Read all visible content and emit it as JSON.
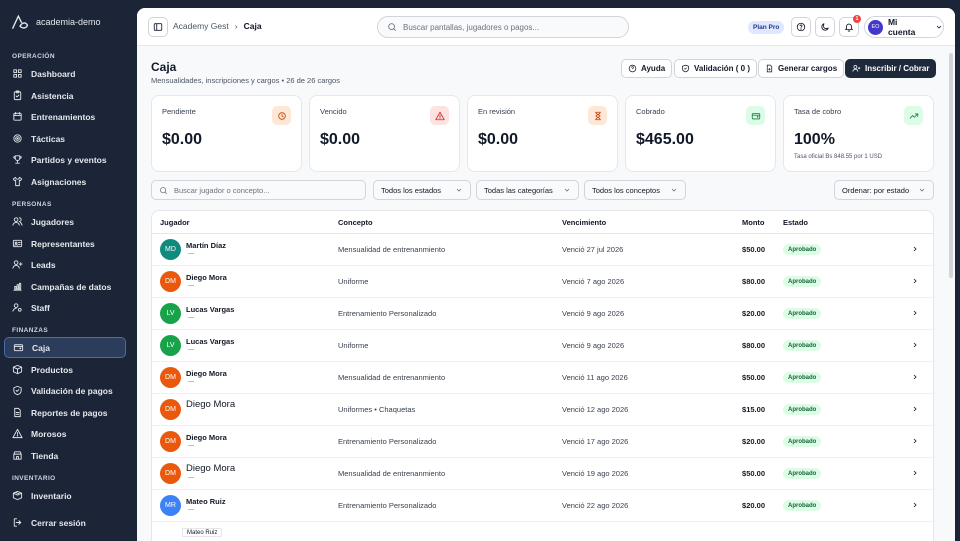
{
  "brand": {
    "name": "academia-demo"
  },
  "sidebar": {
    "sections": [
      {
        "title": "OPERACIÓN",
        "items": [
          {
            "label": "Dashboard",
            "icon": "grid-icon"
          },
          {
            "label": "Asistencia",
            "icon": "clipboard-icon"
          },
          {
            "label": "Entrenamientos",
            "icon": "calendar-icon"
          },
          {
            "label": "Tácticas",
            "icon": "target-icon"
          },
          {
            "label": "Partidos y eventos",
            "icon": "trophy-icon"
          },
          {
            "label": "Asignaciones",
            "icon": "shirt-icon"
          }
        ]
      },
      {
        "title": "PERSONAS",
        "items": [
          {
            "label": "Jugadores",
            "icon": "users-icon"
          },
          {
            "label": "Representantes",
            "icon": "id-card-icon"
          },
          {
            "label": "Leads",
            "icon": "user-plus-icon"
          },
          {
            "label": "Campañas de datos",
            "icon": "chart-icon"
          },
          {
            "label": "Staff",
            "icon": "user-cog-icon"
          }
        ]
      },
      {
        "title": "FINANZAS",
        "items": [
          {
            "label": "Caja",
            "icon": "wallet-icon",
            "active": true
          },
          {
            "label": "Productos",
            "icon": "box-icon"
          },
          {
            "label": "Validación de pagos",
            "icon": "shield-check-icon"
          },
          {
            "label": "Reportes de pagos",
            "icon": "file-icon"
          },
          {
            "label": "Morosos",
            "icon": "alert-icon"
          },
          {
            "label": "Tienda",
            "icon": "store-icon"
          }
        ]
      },
      {
        "title": "INVENTARIO",
        "items": [
          {
            "label": "Inventario",
            "icon": "package-icon"
          }
        ]
      }
    ],
    "logout": "Cerrar sesión"
  },
  "topbar": {
    "breadcrumb_root": "Academy Gest",
    "breadcrumb_sep": "›",
    "breadcrumb_current": "Caja",
    "search_placeholder": "Buscar pantallas, jugadores o pagos...",
    "plan": "Plan Pro",
    "notif_count": "1",
    "account_initials": "EO",
    "account_label": "Mi cuenta"
  },
  "page": {
    "title": "Caja",
    "subtitle": "Mensualidades, inscripciones y cargos • 26 de 26 cargos",
    "buttons": {
      "help": "Ayuda",
      "validation": "Validación ( 0 )",
      "generate": "Generar cargos",
      "enroll": "Inscribir / Cobrar"
    }
  },
  "stats": [
    {
      "label": "Pendiente",
      "value": "$0.00",
      "icon": "clock-icon",
      "color": "#fde8d7",
      "stroke": "#c2410c"
    },
    {
      "label": "Vencido",
      "value": "$0.00",
      "icon": "warning-icon",
      "color": "#fde2e2",
      "stroke": "#dc2626"
    },
    {
      "label": "En revisión",
      "value": "$0.00",
      "icon": "hourglass-icon",
      "color": "#fde8d7",
      "stroke": "#c2410c"
    },
    {
      "label": "Cobrado",
      "value": "$465.00",
      "icon": "wallet-icon",
      "color": "#dcfce7",
      "stroke": "#15803d"
    },
    {
      "label": "Tasa de cobro",
      "value": "100%",
      "sub": "Tasa oficial Bs 848.55 por 1 USD",
      "icon": "trend-up-icon",
      "color": "#dcfce7",
      "stroke": "#15803d"
    }
  ],
  "filters": {
    "search_placeholder": "Buscar jugador o concepto...",
    "states": "Todos los estados",
    "categories": "Todas las categorías",
    "concepts": "Todos los conceptos",
    "order": "Ordenar: por estado"
  },
  "table": {
    "headers": {
      "player": "Jugador",
      "concept": "Concepto",
      "due": "Vencimiento",
      "amount": "Monto",
      "status": "Estado"
    },
    "rows": [
      {
        "initials": "MD",
        "name": "Martín Díaz",
        "dash": "—",
        "concept": "Mensualidad de entrenanmiento",
        "due": "Venció 27 jul 2026",
        "amount": "$50.00",
        "status": "Aprobado",
        "color": "#0f8a7e",
        "big": false
      },
      {
        "initials": "DM",
        "name": "Diego Mora",
        "dash": "—",
        "concept": "Uniforme",
        "due": "Venció 7 ago 2026",
        "amount": "$80.00",
        "status": "Aprobado",
        "color": "#ea580c",
        "big": false
      },
      {
        "initials": "LV",
        "name": "Lucas Vargas",
        "dash": "—",
        "concept": "Entrenamiento Personalizado",
        "due": "Venció 9 ago 2026",
        "amount": "$20.00",
        "status": "Aprobado",
        "color": "#16a34a",
        "big": false
      },
      {
        "initials": "LV",
        "name": "Lucas Vargas",
        "dash": "—",
        "concept": "Uniforme",
        "due": "Venció 9 ago 2026",
        "amount": "$80.00",
        "status": "Aprobado",
        "color": "#16a34a",
        "big": false
      },
      {
        "initials": "DM",
        "name": "Diego Mora",
        "dash": "—",
        "concept": "Mensualidad de entrenanmiento",
        "due": "Venció 11 ago 2026",
        "amount": "$50.00",
        "status": "Aprobado",
        "color": "#ea580c",
        "big": false
      },
      {
        "initials": "DM",
        "name": "Diego Mora",
        "dash": "",
        "concept": "Uniformes • Chaquetas",
        "due": "Venció 12 ago 2026",
        "amount": "$15.00",
        "status": "Aprobado",
        "color": "#ea580c",
        "big": true
      },
      {
        "initials": "DM",
        "name": "Diego Mora",
        "dash": "—",
        "concept": "Entrenamiento Personalizado",
        "due": "Venció 17 ago 2026",
        "amount": "$20.00",
        "status": "Aprobado",
        "color": "#ea580c",
        "big": false
      },
      {
        "initials": "DM",
        "name": "Diego Mora",
        "dash": "—",
        "concept": "Mensualidad de entrenanmiento",
        "due": "Venció 19 ago 2026",
        "amount": "$50.00",
        "status": "Aprobado",
        "color": "#ea580c",
        "big": true
      },
      {
        "initials": "MR",
        "name": "Mateo Ruiz",
        "dash": "—",
        "concept": "Entrenamiento Personalizado",
        "due": "Venció 22 ago 2026",
        "amount": "$20.00",
        "status": "Aprobado",
        "color": "#3b82f6",
        "big": false
      }
    ],
    "tooltip": "Mateo Ruiz"
  }
}
